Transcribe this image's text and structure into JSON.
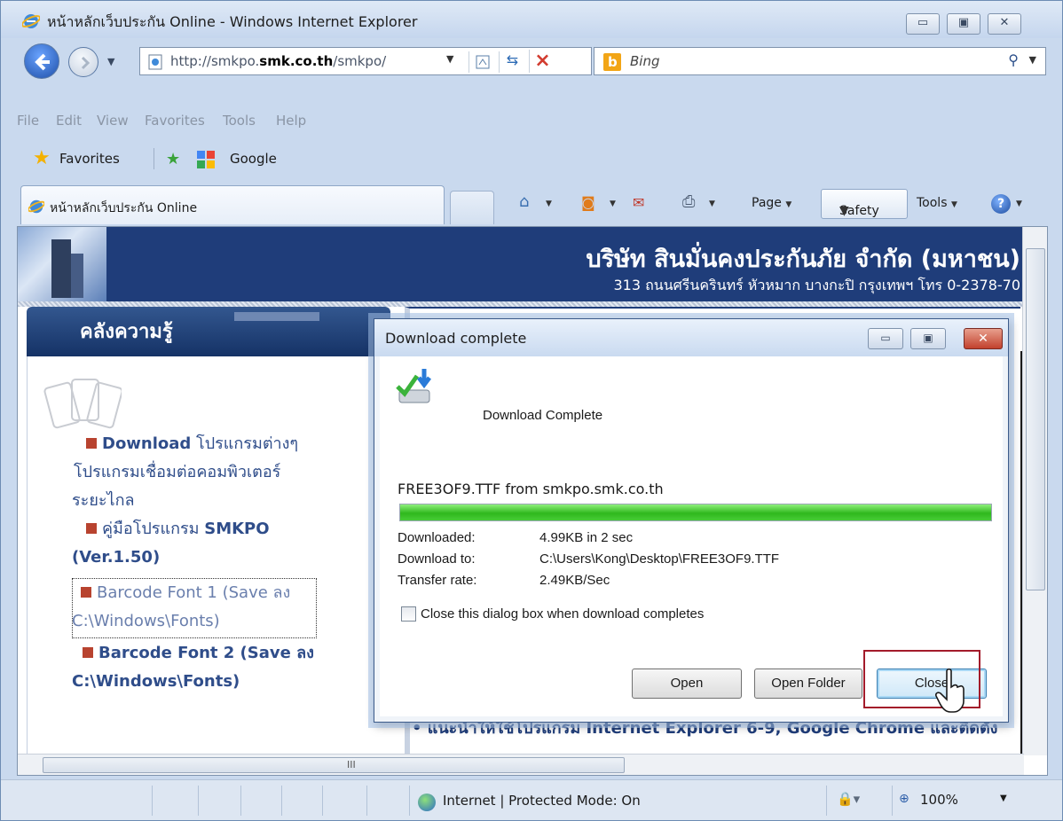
{
  "window": {
    "title": "หน้าหลักเว็บประกัน Online - Windows Internet Explorer",
    "minimize": "▭",
    "maximize": "▣",
    "close": "✕"
  },
  "address": {
    "url_prefix": "http://smkpo.",
    "url_domain": "smk.co.th",
    "url_suffix": "/smkpo/"
  },
  "search": {
    "placeholder": "Bing",
    "engine_icon": "bing-icon"
  },
  "menu": [
    "File",
    "Edit",
    "View",
    "Favorites",
    "Tools",
    "Help"
  ],
  "favorites": {
    "label": "Favorites",
    "items": [
      {
        "label": "Google",
        "icon": "google-icon"
      }
    ]
  },
  "tab": {
    "title": "หน้าหลักเว็บประกัน Online"
  },
  "command_bar": {
    "page": "Page",
    "safety": "Safety",
    "tools": "Tools"
  },
  "site": {
    "company_name": "บริษัท สินมั่นคงประกันภัย จำกัด (มหาชน)",
    "company_address": "313 ถนนศรีนครินทร์ หัวหมาก บางกะปิ กรุงเทพฯ โทร 0-2378-70",
    "sidebar_title": "คลังความรู้",
    "links": [
      {
        "text_bold": "Download",
        "text_rest": " โปรแกรมต่างๆ"
      },
      {
        "text_line2": "โปรแกรมเชื่อมต่อคอมพิวเตอร์"
      },
      {
        "text_line3": "ระยะไกล"
      },
      {
        "text_prefix": "คู่มือโปรแกรม ",
        "text_bold": "SMKPO"
      },
      {
        "text_line2": "(Ver.1.50)"
      },
      {
        "text_line1": "Barcode Font 1 (Save ลง",
        "text_line2": "C:\\Windows\\Fonts)"
      },
      {
        "text_line1": "Barcode Font 2 (Save ลง",
        "text_line2": "C:\\Windows\\Fonts)"
      }
    ],
    "tip": "• แนะนำให้ใช้โปรแกรม Internet Explorer 6-9, Google Chrome และติดตั้ง"
  },
  "dialog": {
    "title": "Download complete",
    "heading": "Download Complete",
    "file_line": "FREE3OF9.TTF from smkpo.smk.co.th",
    "progress": 1.0,
    "downloaded_label": "Downloaded:",
    "downloaded_value": "4.99KB in 2 sec",
    "download_to_label": "Download to:",
    "download_to_value": "C:\\Users\\Kong\\Desktop\\FREE3OF9.TTF",
    "transfer_rate_label": "Transfer rate:",
    "transfer_rate_value": "2.49KB/Sec",
    "checkbox_label": "Close this dialog box when download completes",
    "checkbox_checked": false,
    "buttons": {
      "open": "Open",
      "open_folder": "Open Folder",
      "close": "Close"
    }
  },
  "status": {
    "zone": "Internet | Protected Mode: On",
    "zoom": "100%"
  },
  "colors": {
    "header_blue": "#1f3d7a",
    "link_blue": "#2f4d8a",
    "bullet_red": "#b8432f",
    "highlight_red": "#a31b2a",
    "progress_green": "#2fb81d"
  }
}
